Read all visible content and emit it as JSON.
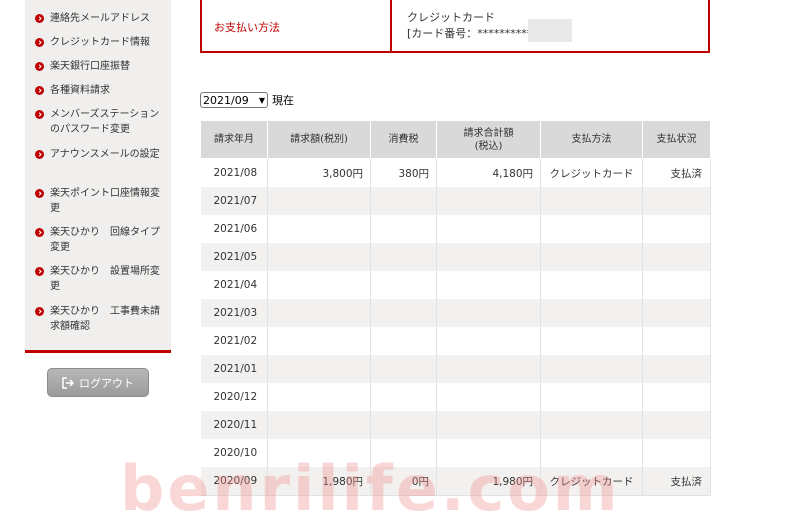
{
  "sidebar": {
    "items": [
      {
        "label": "連絡先メールアドレス"
      },
      {
        "label": "クレジットカード情報"
      },
      {
        "label": "楽天銀行口座振替"
      },
      {
        "label": "各種資料請求"
      },
      {
        "label": "メンバーズステーションのパスワード変更"
      },
      {
        "label": "アナウンスメールの設定"
      },
      {
        "label": "楽天ポイント口座情報変更"
      },
      {
        "label": "楽天ひかり　回線タイプ変更"
      },
      {
        "label": "楽天ひかり　設置場所変更"
      },
      {
        "label": "楽天ひかり　工事費未請求額確認"
      }
    ],
    "logout_label": "ログアウト"
  },
  "payment": {
    "label": "お支払い方法",
    "method": "クレジットカード",
    "card_number": "[カード番号：*************"
  },
  "month_filter": {
    "selected": "2021/09",
    "suffix": "現在"
  },
  "table": {
    "headers": [
      "請求年月",
      "請求額(税別)",
      "消費税",
      "請求合計額\n(税込)",
      "支払方法",
      "支払状況"
    ],
    "rows": [
      [
        "2021/08",
        "3,800円",
        "380円",
        "4,180円",
        "クレジットカード",
        "支払済"
      ],
      [
        "2021/07",
        "",
        "",
        "",
        "",
        ""
      ],
      [
        "2021/06",
        "",
        "",
        "",
        "",
        ""
      ],
      [
        "2021/05",
        "",
        "",
        "",
        "",
        ""
      ],
      [
        "2021/04",
        "",
        "",
        "",
        "",
        ""
      ],
      [
        "2021/03",
        "",
        "",
        "",
        "",
        ""
      ],
      [
        "2021/02",
        "",
        "",
        "",
        "",
        ""
      ],
      [
        "2021/01",
        "",
        "",
        "",
        "",
        ""
      ],
      [
        "2020/12",
        "",
        "",
        "",
        "",
        ""
      ],
      [
        "2020/11",
        "",
        "",
        "",
        "",
        ""
      ],
      [
        "2020/10",
        "",
        "",
        "",
        "",
        ""
      ],
      [
        "2020/09",
        "1,980円",
        "0円",
        "1,980円",
        "クレジットカード",
        "支払済"
      ]
    ]
  },
  "watermark": "benrilife.com",
  "colors": {
    "accent": "#bf0000",
    "header_bg": "#d9d9d9",
    "sidebar_bg": "#f0efed"
  }
}
